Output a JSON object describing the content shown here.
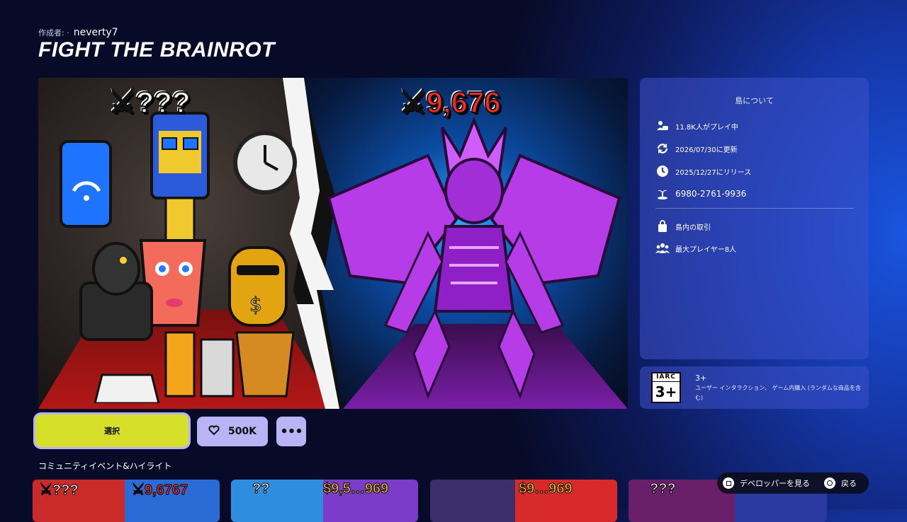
{
  "header": {
    "creator_prefix": "作成者: ·",
    "creator_name": "neverty7",
    "title": "FIGHT THE BRAINROT"
  },
  "hero": {
    "left_label": "⚔???",
    "right_label": "⚔9,676"
  },
  "info": {
    "title": "島について",
    "players_playing": "11.8K人がプレイ中",
    "updated": "2026/07/30に更新",
    "released": "2025/12/27にリリース",
    "island_code": "6980-2761-9936",
    "in_island_purchases": "島内の取引",
    "max_players": "最大プレイヤー8人"
  },
  "rating": {
    "badge_top": "IARC",
    "badge_num": "3+",
    "age": "3+",
    "description": "ユーザー インタラクション、 ゲーム内購入 (ランダムな商品を含む)"
  },
  "actions": {
    "select_label": "選択",
    "like_count": "500K",
    "more_label": "•••"
  },
  "community": {
    "section_title": "コミュニティイベント&ハイライト",
    "thumbs": [
      {
        "left": "⚔???",
        "right": "⚔9,6767"
      },
      {
        "left": "??",
        "right": "$9,5…969"
      },
      {
        "left": "",
        "right": "$9…969"
      },
      {
        "left": "???",
        "right": ""
      }
    ]
  },
  "hints": {
    "developer": "デベロッパーを見る",
    "back": "戻る"
  }
}
